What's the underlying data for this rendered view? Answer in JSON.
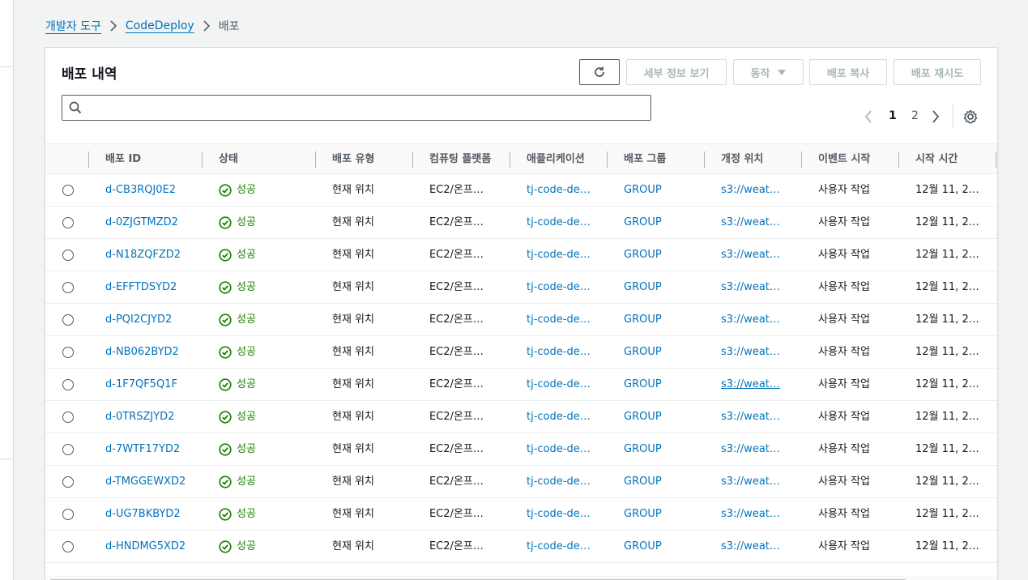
{
  "breadcrumb": {
    "items": [
      "개발자 도구",
      "CodeDeploy"
    ],
    "current": "배포"
  },
  "panel": {
    "title": "배포 내역",
    "buttons": {
      "view_details": "세부 정보 보기",
      "actions": "동작",
      "copy": "배포 복사",
      "retry": "배포 재시도"
    },
    "search": {
      "placeholder": "",
      "value": ""
    },
    "pagination": {
      "pages": [
        "1",
        "2"
      ],
      "current": "1"
    }
  },
  "table": {
    "columns": [
      "배포 ID",
      "상태",
      "배포 유형",
      "컴퓨팅 플랫폼",
      "애플리케이션",
      "배포 그룹",
      "개정 위치",
      "이벤트 시작",
      "시작 시간"
    ],
    "rows": [
      {
        "id": "d-CB3RQJ0E2",
        "status": "성공",
        "type": "현재 위치",
        "platform": "EC2/온프…",
        "app": "tj-code-de…",
        "group": "GROUP",
        "revision": "s3://weat…",
        "event": "사용자 작업",
        "start": "12월 11, 2…"
      },
      {
        "id": "d-0ZJGTMZD2",
        "status": "성공",
        "type": "현재 위치",
        "platform": "EC2/온프…",
        "app": "tj-code-de…",
        "group": "GROUP",
        "revision": "s3://weat…",
        "event": "사용자 작업",
        "start": "12월 11, 2…"
      },
      {
        "id": "d-N18ZQFZD2",
        "status": "성공",
        "type": "현재 위치",
        "platform": "EC2/온프…",
        "app": "tj-code-de…",
        "group": "GROUP",
        "revision": "s3://weat…",
        "event": "사용자 작업",
        "start": "12월 11, 2…"
      },
      {
        "id": "d-EFFTDSYD2",
        "status": "성공",
        "type": "현재 위치",
        "platform": "EC2/온프…",
        "app": "tj-code-de…",
        "group": "GROUP",
        "revision": "s3://weat…",
        "event": "사용자 작업",
        "start": "12월 11, 2…"
      },
      {
        "id": "d-PQI2CJYD2",
        "status": "성공",
        "type": "현재 위치",
        "platform": "EC2/온프…",
        "app": "tj-code-de…",
        "group": "GROUP",
        "revision": "s3://weat…",
        "event": "사용자 작업",
        "start": "12월 11, 2…"
      },
      {
        "id": "d-NB062BYD2",
        "status": "성공",
        "type": "현재 위치",
        "platform": "EC2/온프…",
        "app": "tj-code-de…",
        "group": "GROUP",
        "revision": "s3://weat…",
        "event": "사용자 작업",
        "start": "12월 11, 2…"
      },
      {
        "id": "d-1F7QF5Q1F",
        "status": "성공",
        "type": "현재 위치",
        "platform": "EC2/온프…",
        "app": "tj-code-de…",
        "group": "GROUP",
        "revision": "s3://weat…",
        "event": "사용자 작업",
        "start": "12월 11, 2…"
      },
      {
        "id": "d-0TRSZJYD2",
        "status": "성공",
        "type": "현재 위치",
        "platform": "EC2/온프…",
        "app": "tj-code-de…",
        "group": "GROUP",
        "revision": "s3://weat…",
        "event": "사용자 작업",
        "start": "12월 11, 2…"
      },
      {
        "id": "d-7WTF17YD2",
        "status": "성공",
        "type": "현재 위치",
        "platform": "EC2/온프…",
        "app": "tj-code-de…",
        "group": "GROUP",
        "revision": "s3://weat…",
        "event": "사용자 작업",
        "start": "12월 11, 2…"
      },
      {
        "id": "d-TMGGEWXD2",
        "status": "성공",
        "type": "현재 위치",
        "platform": "EC2/온프…",
        "app": "tj-code-de…",
        "group": "GROUP",
        "revision": "s3://weat…",
        "event": "사용자 작업",
        "start": "12월 11, 2…"
      },
      {
        "id": "d-UG7BKBYD2",
        "status": "성공",
        "type": "현재 위치",
        "platform": "EC2/온프…",
        "app": "tj-code-de…",
        "group": "GROUP",
        "revision": "s3://weat…",
        "event": "사용자 작업",
        "start": "12월 11, 2…"
      },
      {
        "id": "d-HNDMG5XD2",
        "status": "성공",
        "type": "현재 위치",
        "platform": "EC2/온프…",
        "app": "tj-code-de…",
        "group": "GROUP",
        "revision": "s3://weat…",
        "event": "사용자 작업",
        "start": "12월 11, 2…"
      }
    ]
  },
  "colors": {
    "link": "#0073bb",
    "success": "#1d8102",
    "disabled_text": "#aab7b8",
    "header_text": "#545b64"
  }
}
